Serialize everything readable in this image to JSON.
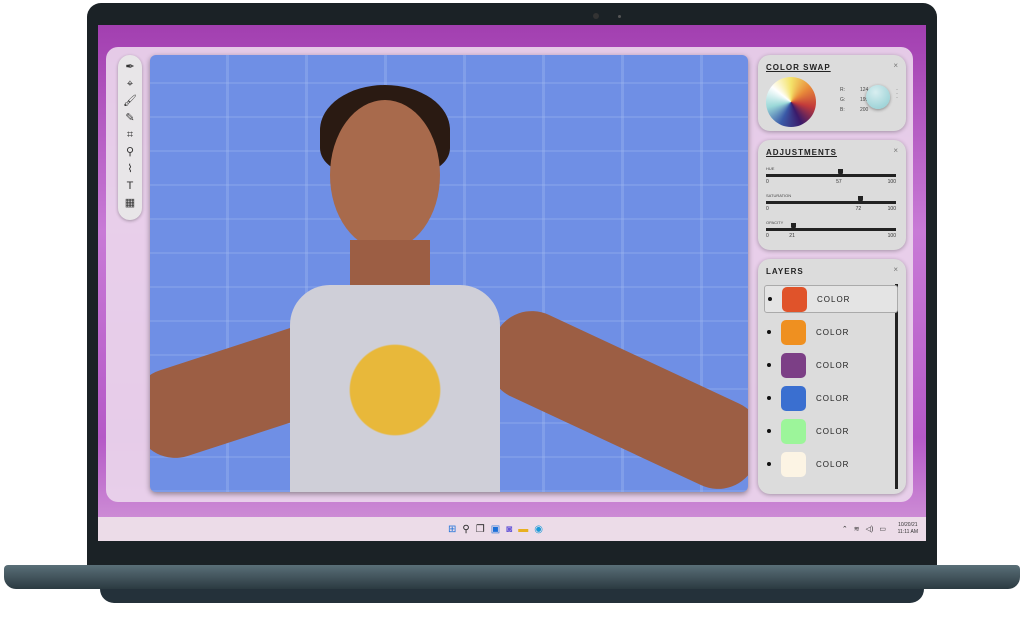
{
  "toolbar": {
    "tools": [
      {
        "icon": "pen-icon",
        "glyph": "✒"
      },
      {
        "icon": "pen-tool-icon",
        "glyph": "⌖"
      },
      {
        "icon": "brush-icon",
        "glyph": "🖌"
      },
      {
        "icon": "pencil-icon",
        "glyph": "✎"
      },
      {
        "icon": "crop-icon",
        "glyph": "⌗"
      },
      {
        "icon": "zoom-icon",
        "glyph": "⚲"
      },
      {
        "icon": "eyedropper-icon",
        "glyph": "⌇"
      },
      {
        "icon": "text-icon",
        "glyph": "T"
      },
      {
        "icon": "gradient-icon",
        "glyph": "▦"
      }
    ]
  },
  "color_swap": {
    "title": "COLOR SWAP",
    "close": "×",
    "r_label": "R:",
    "r": "124",
    "g_label": "G:",
    "g": "199",
    "b_label": "B:",
    "b": "200",
    "swatch_color": "#7cc7c8"
  },
  "adjustments": {
    "title": "ADJUSTMENTS",
    "close": "×",
    "sliders": [
      {
        "label": "HUE",
        "min": "0",
        "max": "100",
        "value": "57"
      },
      {
        "label": "SATURATION",
        "min": "0",
        "max": "100",
        "value": "72"
      },
      {
        "label": "OPACITY",
        "min": "0",
        "max": "100",
        "value": "21"
      }
    ]
  },
  "layers": {
    "title": "LAYERS",
    "close": "×",
    "items": [
      {
        "label": "COLOR",
        "color": "#e0532a"
      },
      {
        "label": "COLOR",
        "color": "#ef9020"
      },
      {
        "label": "COLOR",
        "color": "#7c3f86"
      },
      {
        "label": "COLOR",
        "color": "#3a6fd0"
      },
      {
        "label": "COLOR",
        "color": "#9cf59a"
      },
      {
        "label": "COLOR",
        "color": "#fcf4e4"
      }
    ]
  },
  "taskbar": {
    "icons": [
      "windows-icon",
      "search-icon",
      "task-view-icon",
      "widgets-icon",
      "chat-icon",
      "file-explorer-icon",
      "edge-icon"
    ],
    "date": "10/20/21",
    "time": "11:11 AM"
  }
}
